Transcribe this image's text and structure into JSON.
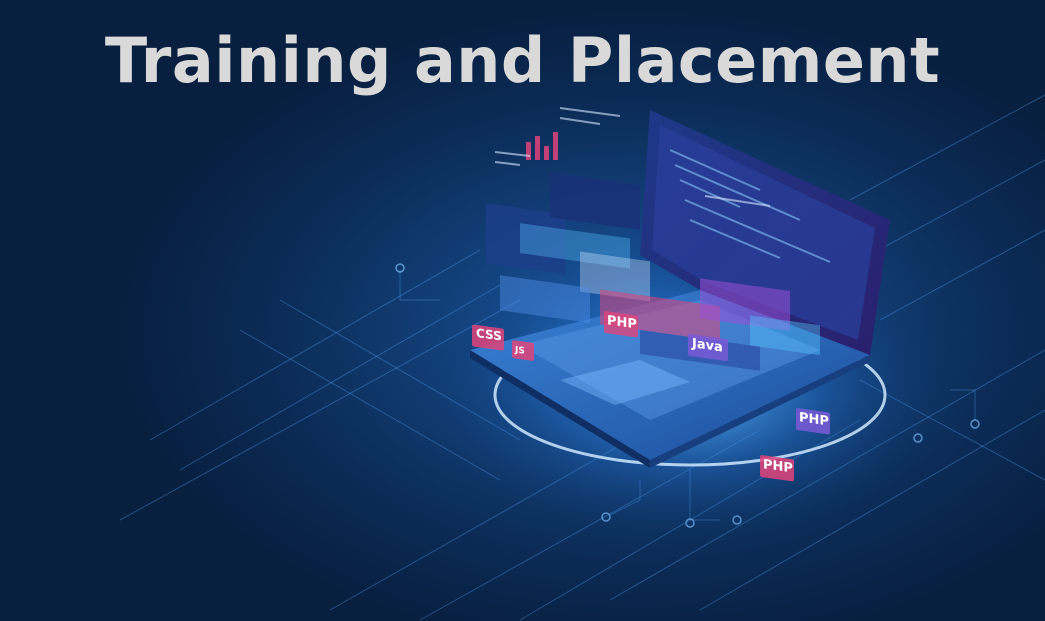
{
  "banner": {
    "title": "Training and Placement"
  },
  "laptop_screen_tags": {
    "php_1": "PHP",
    "php_2": "PHP",
    "php_3": "PHP",
    "java": "Java",
    "css": "CSS",
    "js": "JS"
  },
  "colors": {
    "background_dark": "#081f40",
    "background_glow": "#1a5fb0",
    "title_text": "#d9d9d9",
    "circuit_lines": "#5aa8ff",
    "tag_pink": "#e0447a",
    "tag_purple": "#7a5ad6",
    "screen_cyan": "#56c7ff"
  }
}
